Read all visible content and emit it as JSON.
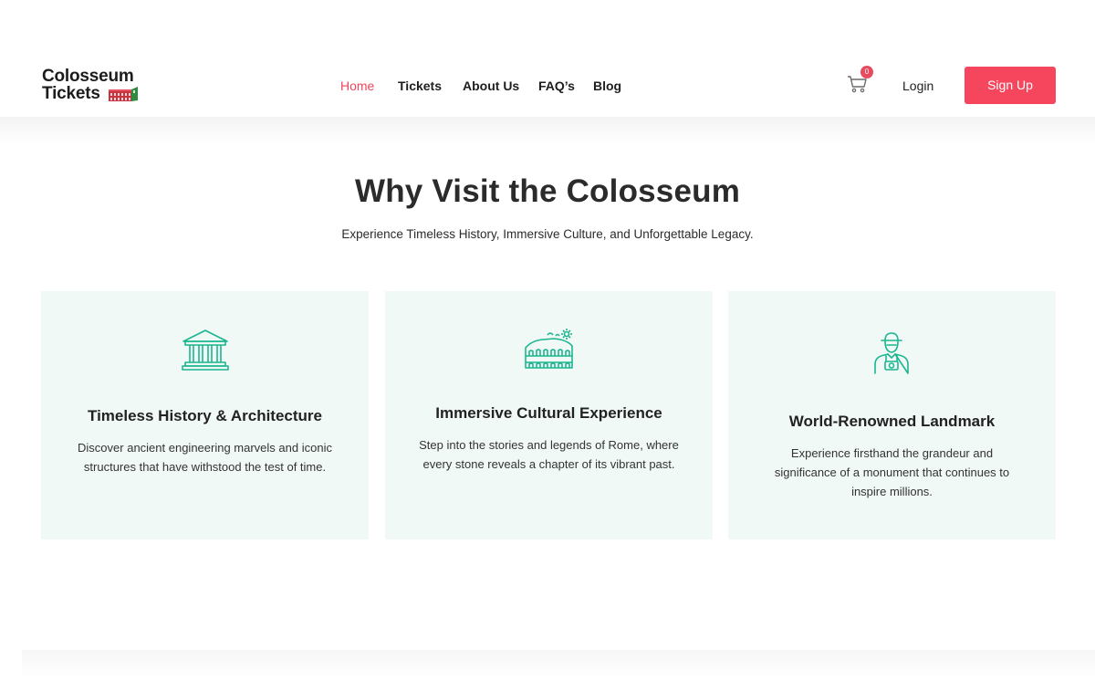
{
  "header": {
    "logo_line1": "Colosseum",
    "logo_line2": "Tickets",
    "nav": [
      {
        "label": "Home",
        "active": true
      },
      {
        "label": "Tickets",
        "active": false
      },
      {
        "label": "About Us",
        "active": false
      },
      {
        "label": "FAQ’s",
        "active": false
      },
      {
        "label": "Blog",
        "active": false
      }
    ],
    "cart_count": "0",
    "login_label": "Login",
    "signup_label": "Sign Up",
    "cart_icon": "cart-icon"
  },
  "section": {
    "title": "Why Visit the Colosseum",
    "subtitle": "Experience Timeless History, Immersive Culture, and Unforgettable Legacy."
  },
  "cards": [
    {
      "icon": "temple-icon",
      "title": "Timeless History & Architecture",
      "text": "Discover ancient engineering marvels and iconic structures that have withstood the test of time."
    },
    {
      "icon": "colosseum-icon",
      "title": "Immersive Cultural Experience",
      "text": "Step into the stories and legends of Rome, where every stone reveals a chapter of its vibrant past."
    },
    {
      "icon": "tourist-icon",
      "title": "World-Renowned Landmark",
      "text": "Experience firsthand the grandeur and significance of a monument that continues to inspire millions."
    }
  ],
  "colors": {
    "accent": "#f5465e",
    "icon_teal": "#1bb58f",
    "card_bg": "#f1f9f7"
  }
}
